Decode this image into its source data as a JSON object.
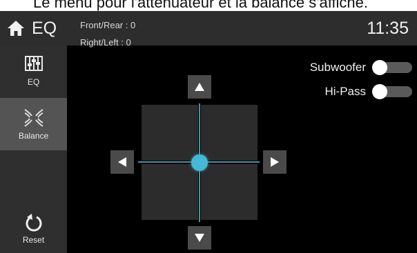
{
  "caption": "Le menu pour l'atténuateur et la balance s'affiche.",
  "header": {
    "title": "EQ",
    "time": "11:35"
  },
  "sidebar": {
    "items": [
      {
        "label": "EQ",
        "icon": "eq-sliders-icon",
        "selected": false
      },
      {
        "label": "Balance",
        "icon": "balance-waves-icon",
        "selected": true
      },
      {
        "label": "Reset",
        "icon": "reset-icon",
        "selected": false
      }
    ]
  },
  "balance": {
    "front_rear_label": "Front/Rear : 0",
    "right_left_label": "Right/Left : 0",
    "front_rear_value": 0,
    "right_left_value": 0
  },
  "toggles": [
    {
      "label": "Subwoofer",
      "on": false
    },
    {
      "label": "Hi-Pass",
      "on": false
    }
  ],
  "colors": {
    "accent": "#45b8d6",
    "header_bg": "#2d2d2d",
    "sidebar_bg": "#2f2f2f",
    "selected_bg": "#545454"
  }
}
